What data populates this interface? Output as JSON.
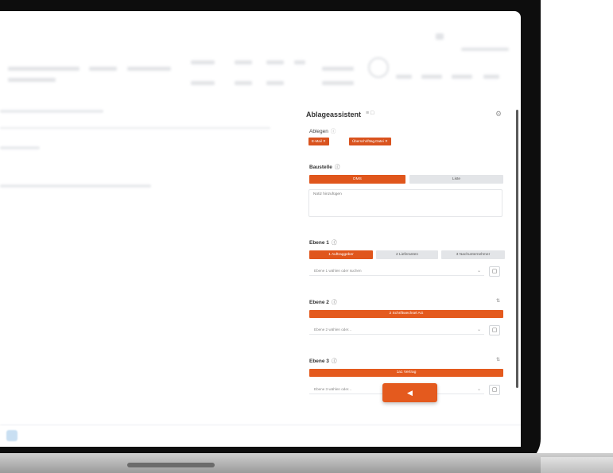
{
  "panel": {
    "title": "Ablageassistent",
    "title_icons": "≡ □",
    "gear_icon": "gear-icon",
    "ablegen": {
      "label": "Ablegen",
      "chips": [
        "E-Mail",
        "Überschrifttag.Datei"
      ]
    },
    "baustelle": {
      "label": "Baustelle",
      "seg_left": "DMS",
      "seg_right": "Liste",
      "notiz_placeholder": "Notiz hinzufügen"
    },
    "ebene1": {
      "label": "Ebene 1",
      "tabs": [
        "1 Auftraggeber",
        "2 Lieferanten",
        "3 Nachunternehmer"
      ],
      "select_placeholder": "Ebene 1 wählen oder suchen"
    },
    "ebene2": {
      "label": "Ebene 2",
      "bar": "2 Schriftwechsel AG",
      "select_placeholder": "Ebene 2 wählen oder..."
    },
    "ebene3": {
      "label": "Ebene 3",
      "bar": "1a1 Vertrag",
      "select_placeholder": "Ebene 3 wählen oder..."
    },
    "send_icon": "send-icon"
  },
  "colors": {
    "accent": "#e0561c",
    "chip": "#d9531e"
  }
}
